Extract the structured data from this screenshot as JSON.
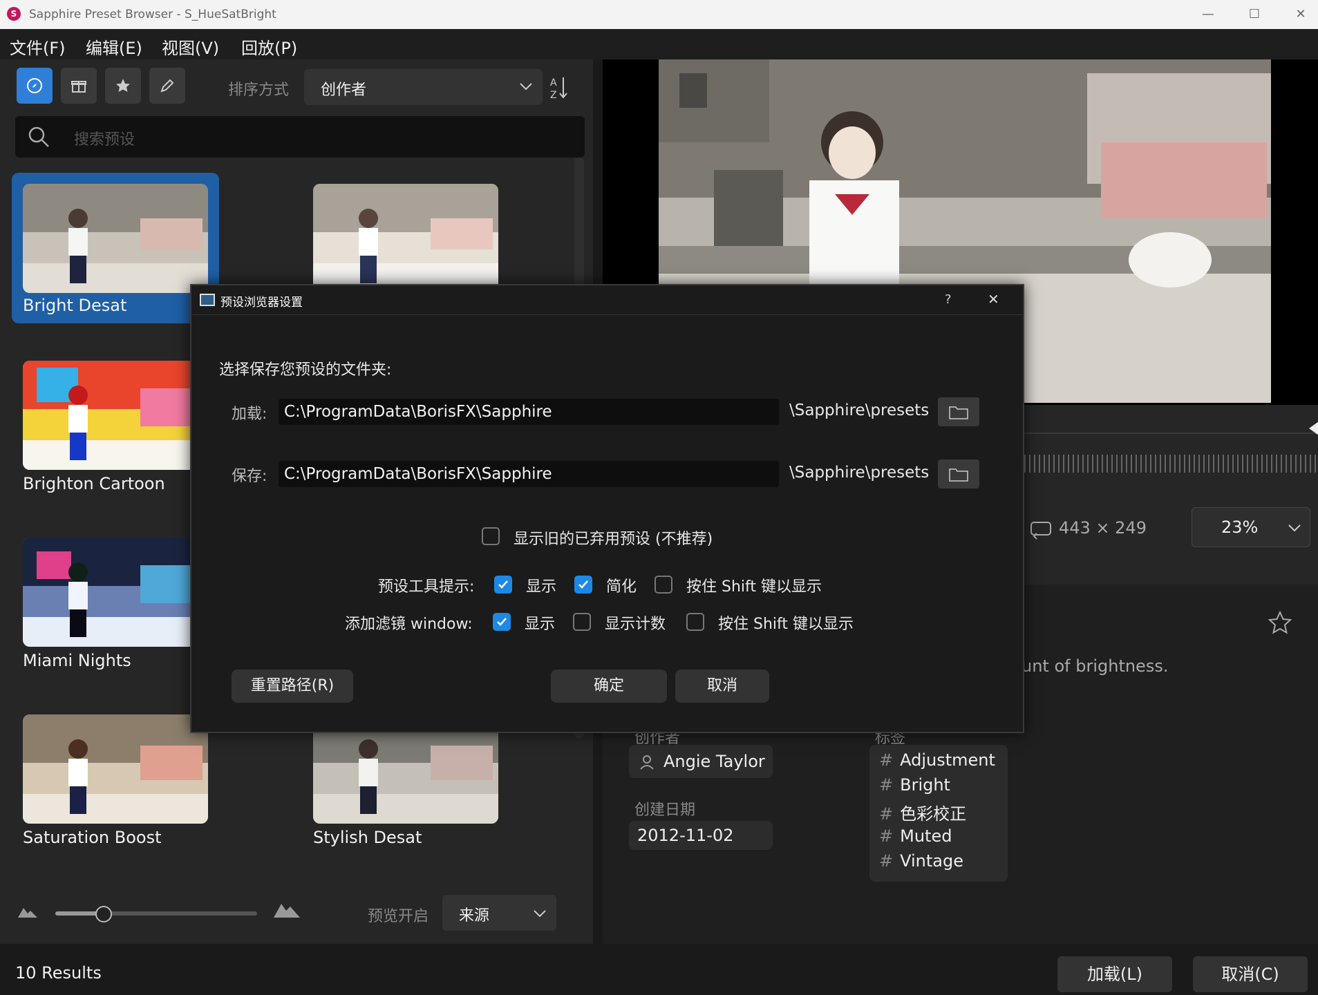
{
  "window": {
    "title": "Sapphire Preset Browser - S_HueSatBright",
    "app_icon_letter": "S",
    "controls": [
      "—",
      "☐",
      "✕"
    ]
  },
  "menu": [
    {
      "label": "文件(F)"
    },
    {
      "label": "编辑(E)"
    },
    {
      "label": "视图(V)"
    },
    {
      "label": "回放(P)"
    }
  ],
  "toolbar": {
    "buttons": [
      {
        "icon": "compass-icon",
        "active": true
      },
      {
        "icon": "gift-icon",
        "active": false
      },
      {
        "icon": "star-icon",
        "active": false
      },
      {
        "icon": "pencil-icon",
        "active": false
      }
    ],
    "sort_label": "排序方式",
    "sort_value": "创作者"
  },
  "search": {
    "placeholder": "搜索预设"
  },
  "presets": [
    {
      "name": "Bright Desat",
      "selected": true,
      "style": "desat"
    },
    {
      "name": "",
      "selected": false,
      "style": "bright"
    },
    {
      "name": "Brighton Cartoon",
      "selected": false,
      "style": "cartoon"
    },
    {
      "name": "Miami Nights",
      "selected": false,
      "style": "miami"
    },
    {
      "name": "Saturation Boost",
      "selected": false,
      "style": "sat"
    },
    {
      "name": "Stylish Desat",
      "selected": false,
      "style": "desat"
    }
  ],
  "bottom_left": {
    "slider_level": 0.24,
    "preview_label": "预览开启",
    "preview_value": "来源",
    "results": "10 Results"
  },
  "preview": {
    "dims": "443 × 249",
    "zoom": "23%"
  },
  "info": {
    "description_fragment": "unt of brightness.",
    "author_label": "创作者",
    "author": "Angie Taylor",
    "tags_label": "标签",
    "tags": [
      "Adjustment",
      "Bright",
      "色彩校正",
      "Muted",
      "Vintage"
    ],
    "date_label": "创建日期",
    "date": "2012-11-02"
  },
  "footer": {
    "load": "加载(L)",
    "cancel": "取消(C)"
  },
  "dialog": {
    "title": "预设浏览器设置",
    "help": "?",
    "close": "✕",
    "prompt": "选择保存您预设的文件夹:",
    "load_label": "加载:",
    "load_path": "C:\\ProgramData\\BorisFX\\Sapphire",
    "load_suffix": "\\Sapphire\\presets",
    "save_label": "保存:",
    "save_path": "C:\\ProgramData\\BorisFX\\Sapphire",
    "save_suffix": "\\Sapphire\\presets",
    "legacy_label": "显示旧的已弃用预设 (不推荐)",
    "legacy_checked": false,
    "tooltip_label": "预设工具提示:",
    "tooltip_show": "显示",
    "tooltip_show_checked": true,
    "tooltip_simple": "简化",
    "tooltip_simple_checked": true,
    "tooltip_shift": "按住 Shift 键以显示",
    "tooltip_shift_checked": false,
    "filter_label": "添加滤镜 window:",
    "filter_show": "显示",
    "filter_show_checked": true,
    "filter_count": "显示计数",
    "filter_count_checked": false,
    "filter_shift": "按住 Shift 键以显示",
    "filter_shift_checked": false,
    "reset": "重置路径(R)",
    "ok": "确定",
    "cancel": "取消"
  }
}
